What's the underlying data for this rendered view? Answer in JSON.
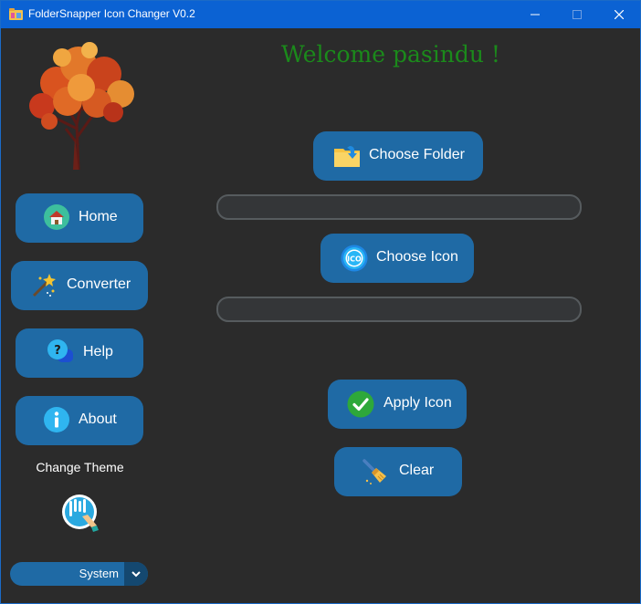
{
  "window": {
    "title": "FolderSnapper Icon Changer V0.2"
  },
  "sidebar": {
    "items": [
      {
        "label": "Home",
        "icon": "home-icon"
      },
      {
        "label": "Converter",
        "icon": "magic-wand-icon"
      },
      {
        "label": "Help",
        "icon": "help-icon"
      },
      {
        "label": "About",
        "icon": "info-icon"
      }
    ],
    "theme_label": "Change Theme",
    "theme_select": {
      "value": "System"
    }
  },
  "main": {
    "welcome": "Welcome pasindu !",
    "choose_folder": "Choose Folder",
    "folder_path": "",
    "choose_icon": "Choose Icon",
    "icon_path": "",
    "apply_icon": "Apply Icon",
    "clear": "Clear"
  },
  "colors": {
    "accent": "#1f6aa5",
    "background": "#2b2b2b",
    "title_bar": "#0b62d3",
    "welcome_text": "#1b8a1b"
  }
}
